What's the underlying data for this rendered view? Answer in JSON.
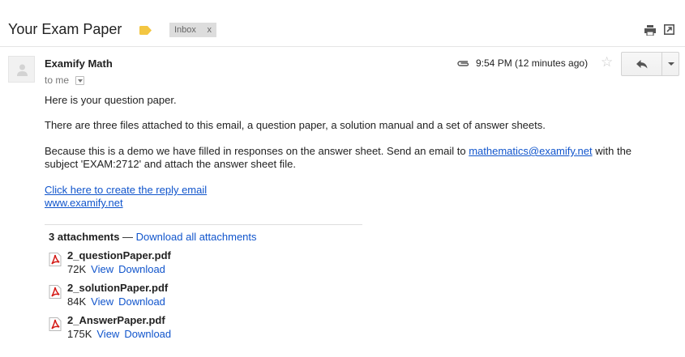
{
  "subject": "Your Exam Paper",
  "label": {
    "name": "Inbox",
    "remove": "x",
    "tag_color": "#f3c642"
  },
  "sender": {
    "name": "Examify Math",
    "to": "to me"
  },
  "timestamp": "9:54 PM (12 minutes ago)",
  "star": "☆",
  "body": {
    "p1": "Here is your question paper.",
    "p2": "There are three files attached to this email, a question paper, a solution manual and a set of answer sheets.",
    "p3_before": "Because this is a demo we have filled in responses on the answer sheet. Send an email to ",
    "p3_email": "mathematics@examify.net",
    "p3_after": " with the subject 'EXAM:2712' and attach the answer sheet file.",
    "reply_link": "Click here to create the reply email",
    "site_link": "www.examify.net"
  },
  "attachments_header": {
    "count": "3 attachments",
    "dash": " — ",
    "download_all": "Download all attachments"
  },
  "attachments": [
    {
      "name": "2_questionPaper.pdf",
      "size": "72K",
      "view": "View",
      "download": "Download"
    },
    {
      "name": "2_solutionPaper.pdf",
      "size": "84K",
      "view": "View",
      "download": "Download"
    },
    {
      "name": "2_AnswerPaper.pdf",
      "size": "175K",
      "view": "View",
      "download": "Download"
    }
  ],
  "colors": {
    "link": "#1155cc",
    "pdf_red": "#d41a16"
  }
}
